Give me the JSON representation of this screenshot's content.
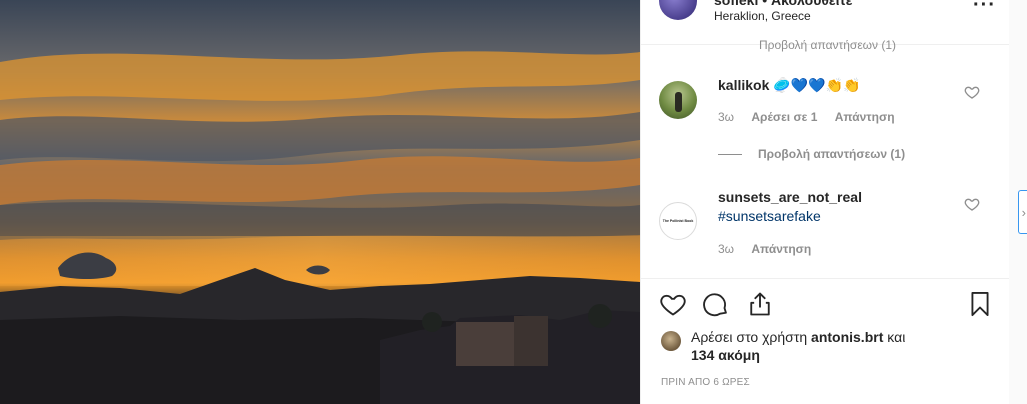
{
  "post": {
    "username": "sofieki",
    "follow_text": "• Ακολουθείτε",
    "location": "Heraklion, Greece",
    "more_icon": "more-options-icon"
  },
  "cut_replies_text": "Προβολή απαντήσεων (1)",
  "comments": [
    {
      "username": "kallikok",
      "text": "🥏💙💙👏👏",
      "age": "3ω",
      "likes": "Αρέσει σε 1",
      "reply": "Απάντηση",
      "view_replies": "Προβολή απαντήσεων (1)"
    },
    {
      "username": "sunsets_are_not_real",
      "avatar_text": "The Pollinist Book",
      "text": "#sunsetsarefake",
      "age": "3ω",
      "reply": "Απάντηση"
    }
  ],
  "actions": {
    "like": "heart-icon",
    "comment": "comment-icon",
    "share": "share-icon",
    "save": "bookmark-icon"
  },
  "likes": {
    "prefix": "Αρέσει στο χρήστη",
    "user": "antonis.brt",
    "middle": "και",
    "count": "134 ακόμη"
  },
  "timestamp": "ΠΡΙΝ ΑΠΟ 6 ΩΡΕΣ",
  "colors": {
    "text": "#262626",
    "secondary": "#8e8e8e",
    "hashtag": "#003569",
    "border": "#efefef"
  }
}
